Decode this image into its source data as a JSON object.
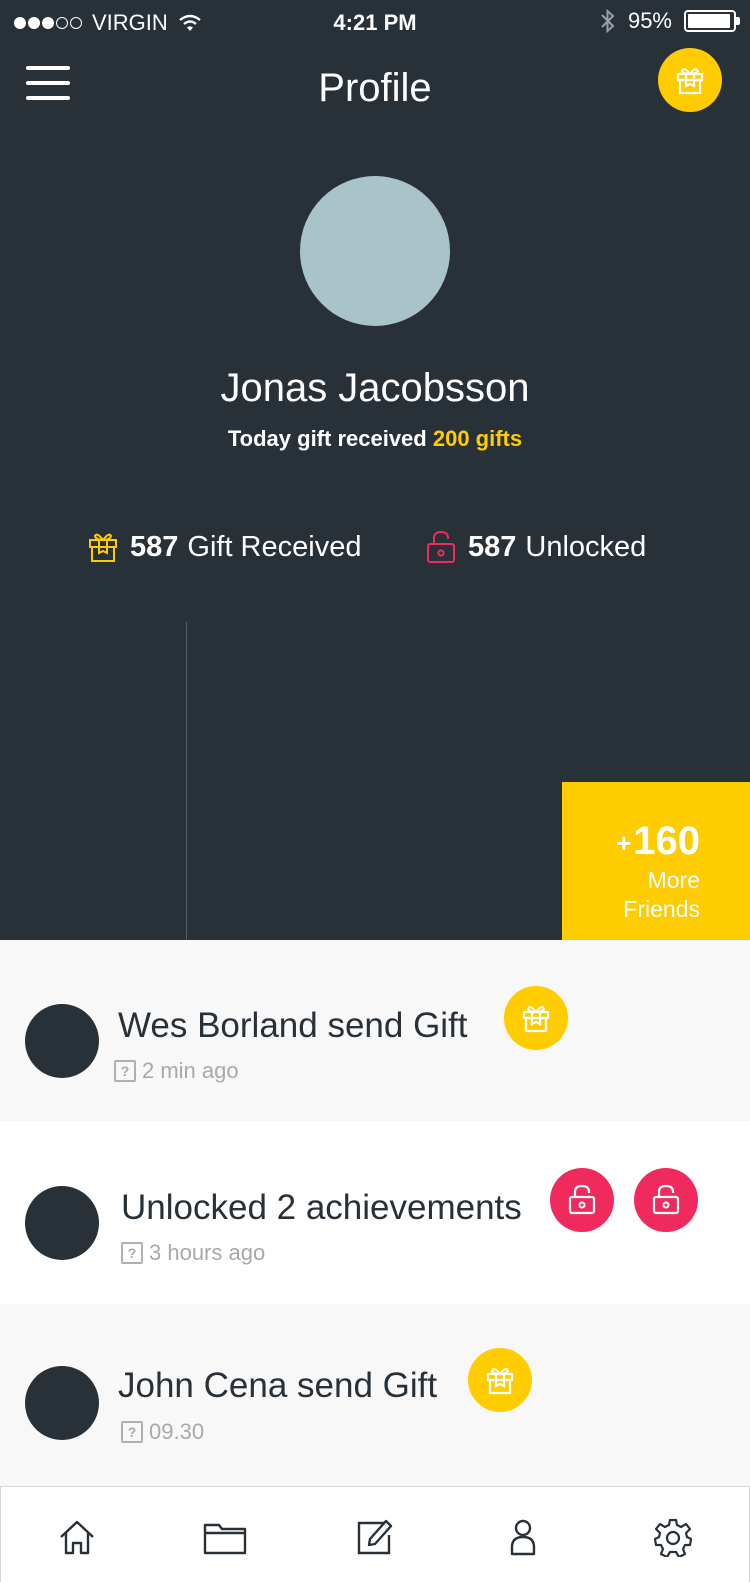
{
  "status_bar": {
    "carrier": "VIRGIN",
    "time": "4:21 PM",
    "battery": "95%",
    "battery_level": 0.95,
    "signal_bars_filled": 3,
    "signal_bars_total": 5
  },
  "header": {
    "title": "Profile"
  },
  "profile": {
    "name": "Jonas Jacobsson",
    "gift_summary_prefix": "Today gift received",
    "gift_summary_value": "200 gifts",
    "stats": [
      {
        "count": "587",
        "label": "Gift Received",
        "icon": "gift-icon"
      },
      {
        "count": "587",
        "label": "Unlocked",
        "icon": "unlock-icon"
      }
    ]
  },
  "more_friends": {
    "plus": "+",
    "count": "160",
    "label_line1": "More",
    "label_line2": "Friends"
  },
  "feed": [
    {
      "title": "Wes Borland send Gift",
      "time": "2 min ago",
      "badges": [
        "gift"
      ]
    },
    {
      "title": "Unlocked 2 achievements",
      "time": "3 hours ago",
      "badges": [
        "unlock",
        "unlock"
      ]
    },
    {
      "title": "John Cena send Gift",
      "time": "09.30",
      "badges": [
        "gift"
      ]
    }
  ],
  "tabbar": [
    "home-icon",
    "folder-icon",
    "edit-icon",
    "user-icon",
    "settings-icon"
  ],
  "colors": {
    "dark": "#283038",
    "accent_yellow": "#ffcc00",
    "accent_red": "#f02a5d",
    "avatar": "#a9c4c8"
  }
}
